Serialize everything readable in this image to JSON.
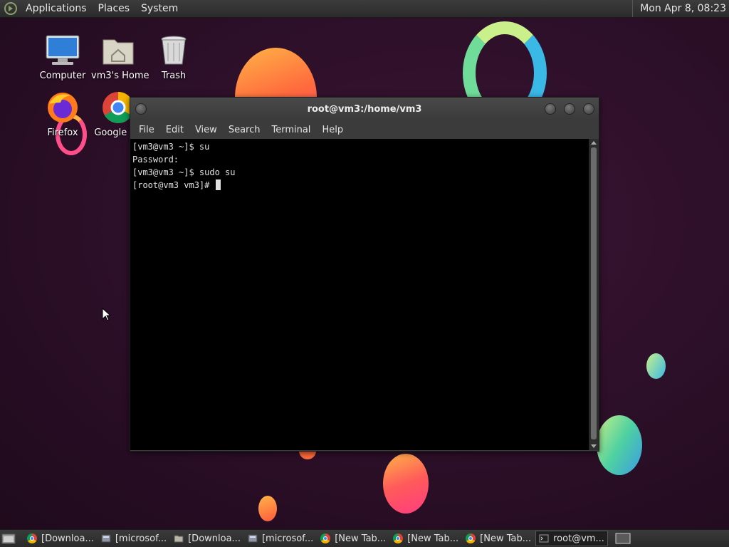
{
  "top_panel": {
    "menus": [
      "Applications",
      "Places",
      "System"
    ],
    "clock": "Mon Apr  8, 08:23"
  },
  "desktop_icons": [
    {
      "label": "Computer",
      "icon": "computer-icon"
    },
    {
      "label": "vm3's Home",
      "icon": "home-folder-icon"
    },
    {
      "label": "Trash",
      "icon": "trash-icon"
    },
    {
      "label": "Firefox",
      "icon": "firefox-icon"
    },
    {
      "label": "Google Ch",
      "icon": "chrome-icon"
    }
  ],
  "terminal": {
    "title": "root@vm3:/home/vm3",
    "menus": [
      "File",
      "Edit",
      "View",
      "Search",
      "Terminal",
      "Help"
    ],
    "lines": [
      "[vm3@vm3 ~]$ su",
      "Password:",
      "[vm3@vm3 ~]$ sudo su",
      "[root@vm3 vm3]# "
    ]
  },
  "taskbar": {
    "items": [
      {
        "label": "[Downloa...",
        "icon": "chrome-icon"
      },
      {
        "label": "[microsof...",
        "icon": "file-manager-icon"
      },
      {
        "label": "[Downloa...",
        "icon": "folder-icon"
      },
      {
        "label": "[microsof...",
        "icon": "file-manager-icon"
      },
      {
        "label": "[New Tab...",
        "icon": "chrome-icon"
      },
      {
        "label": "[New Tab...",
        "icon": "chrome-icon"
      },
      {
        "label": "[New Tab...",
        "icon": "chrome-icon"
      },
      {
        "label": "root@vm...",
        "icon": "terminal-icon"
      }
    ]
  },
  "colors": {
    "wallpaper": "#2a0f26",
    "panel": "#333333",
    "terminal_bg": "#000000",
    "terminal_fg": "#e0e0e0"
  }
}
